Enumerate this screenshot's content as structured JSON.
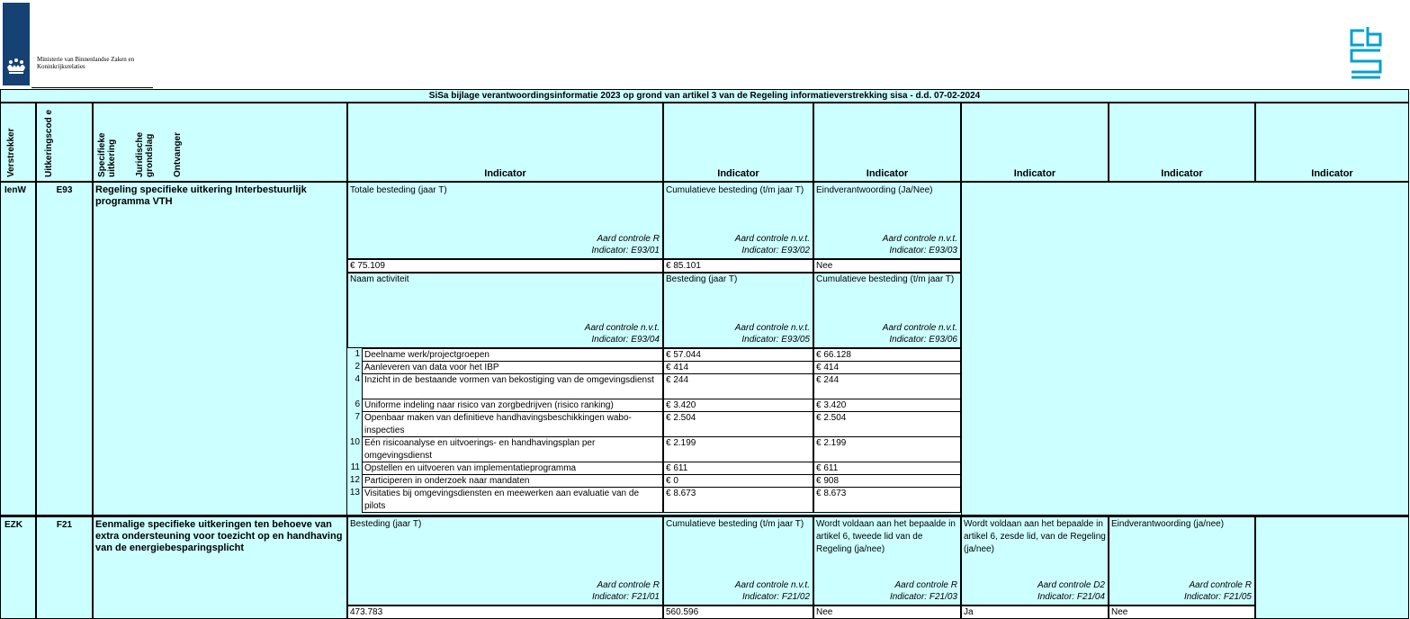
{
  "header": {
    "ministry_line1": "Ministerie van Binnenlandse Zaken en",
    "ministry_line2": "Koninkrijksrelaties",
    "logo_alt": "rijksoverheid-logo",
    "cbs_logo": "cbs-logo"
  },
  "title": "SiSa bijlage verantwoordingsinformatie 2023 op grond van artikel 3 van de Regeling informatieverstrekking sisa - d.d. 07-02-2024",
  "columns": {
    "verstrekker": "Verstrekker",
    "uitkeringscode": "Uitkeringscod e",
    "specifieke": "Specifieke uitkering",
    "juridische": "Juridische grondslag",
    "ontvanger": "Ontvanger",
    "indicator": "Indicator"
  },
  "rows": [
    {
      "verstrekker": "IenW",
      "code": "E93",
      "title": "Regeling specifieke uitkering Interbestuurlijk programma VTH",
      "indicators1": [
        {
          "label": "Totale besteding (jaar T)",
          "aard": "Aard controle R",
          "id": "Indicator: E93/01",
          "value": "€ 75.109"
        },
        {
          "label": "Cumulatieve besteding (t/m jaar T)",
          "aard": "Aard controle n.v.t.",
          "id": "Indicator: E93/02",
          "value": "€ 85.101"
        },
        {
          "label": "Eindverantwoording (Ja/Nee)",
          "aard": "Aard controle n.v.t.",
          "id": "Indicator: E93/03",
          "value": "Nee"
        }
      ],
      "indicators2": [
        {
          "label": "Naam activiteit",
          "aard": "Aard controle n.v.t.",
          "id": "Indicator: E93/04"
        },
        {
          "label": "Besteding (jaar T)",
          "aard": "Aard controle n.v.t.",
          "id": "Indicator: E93/05"
        },
        {
          "label": "Cumulatieve besteding (t/m jaar T)",
          "aard": "Aard controle n.v.t.",
          "id": "Indicator: E93/06"
        }
      ],
      "activities": [
        {
          "nr": "1",
          "name": "Deelname werk/projectgroepen",
          "besteding": "€ 57.044",
          "cumulatief": "€ 66.128"
        },
        {
          "nr": "2",
          "name": "Aanleveren van data voor het IBP",
          "besteding": "€ 414",
          "cumulatief": "€ 414"
        },
        {
          "nr": "4",
          "name": "Inzicht in de bestaande vormen van bekostiging van de omgevingsdienst",
          "besteding": "€ 244",
          "cumulatief": "€ 244"
        },
        {
          "nr": "6",
          "name": "Uniforme indeling naar risico van zorgbedrijven (risico ranking)",
          "besteding": "€ 3.420",
          "cumulatief": "€ 3.420"
        },
        {
          "nr": "7",
          "name": "Openbaar maken van definitieve handhavingsbeschikkingen wabo-inspecties",
          "besteding": "€ 2.504",
          "cumulatief": "€ 2.504"
        },
        {
          "nr": "10",
          "name": "Eén risicoanalyse en uitvoerings- en handhavingsplan per omgevingsdienst",
          "besteding": "€ 2.199",
          "cumulatief": "€ 2.199"
        },
        {
          "nr": "11",
          "name": "Opstellen en uitvoeren van implementatieprogramma",
          "besteding": "€ 611",
          "cumulatief": "€ 611"
        },
        {
          "nr": "12",
          "name": "Participeren in onderzoek naar mandaten",
          "besteding": "€ 0",
          "cumulatief": "€ 908"
        },
        {
          "nr": "13",
          "name": "Visitaties bij omgevingsdiensten en meewerken aan evaluatie van de pilots",
          "besteding": "€ 8.673",
          "cumulatief": "€ 8.673"
        }
      ]
    },
    {
      "verstrekker": "EZK",
      "code": "F21",
      "title": "Eenmalige specifieke uitkeringen ten behoeve van extra ondersteuning voor toezicht op en handhaving van de energiebesparingsplicht",
      "indicators": [
        {
          "label": "Besteding (jaar T)",
          "aard": "Aard controle R",
          "id": "Indicator: F21/01",
          "value": "473.783"
        },
        {
          "label": "Cumulatieve besteding (t/m jaar T)",
          "aard": "Aard controle n.v.t.",
          "id": "Indicator: F21/02",
          "value": "560.596"
        },
        {
          "label": "Wordt voldaan aan het bepaalde in artikel 6, tweede lid van de Regeling (ja/nee)",
          "aard": "Aard controle R",
          "id": "Indicator: F21/03",
          "value": "Nee"
        },
        {
          "label": "Wordt voldaan aan het bepaalde in artikel 6, zesde lid, van de Regeling (ja/nee)",
          "aard": "Aard controle D2",
          "id": "Indicator: F21/04",
          "value": "Ja"
        },
        {
          "label": "Eindverantwoording (ja/nee)",
          "aard": "Aard controle R",
          "id": "Indicator: F21/05",
          "value": "Nee"
        }
      ]
    }
  ],
  "colors": {
    "cell_fill": "#ccffff",
    "logo_blue": "#154273",
    "cbs_cyan": "#00a1cd"
  }
}
